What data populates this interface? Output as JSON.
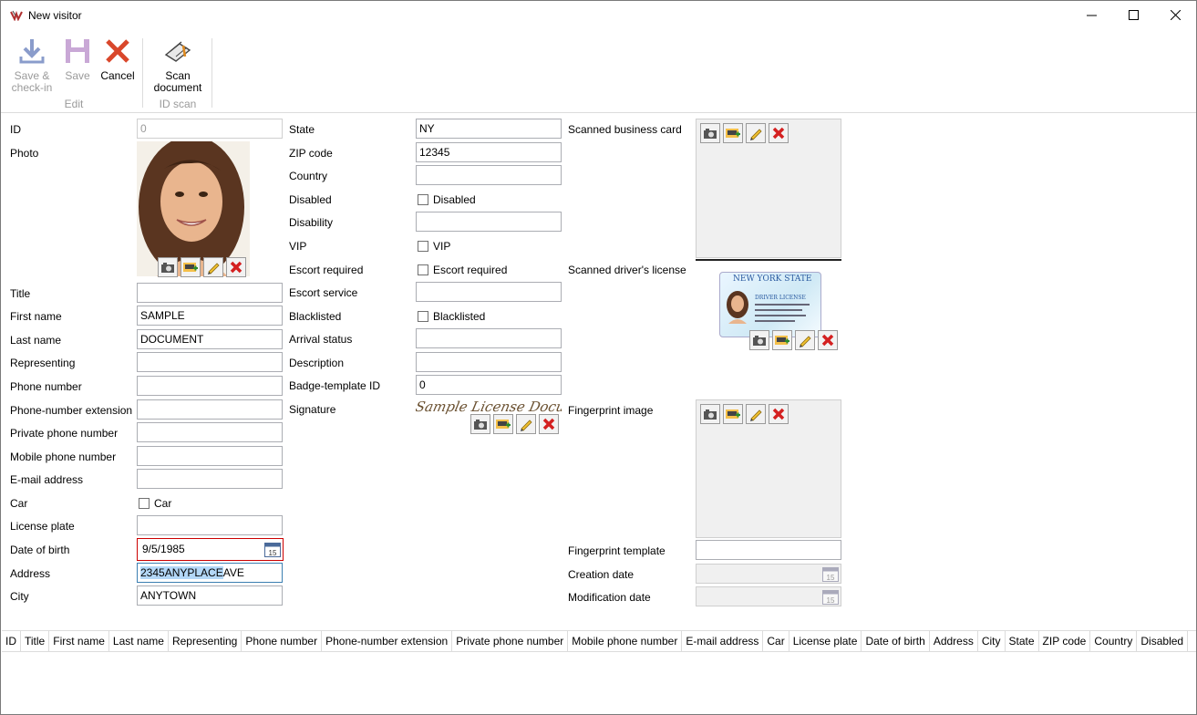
{
  "window": {
    "title": "New visitor"
  },
  "toolbar": {
    "save_checkin_line1": "Save &",
    "save_checkin_line2": "check-in",
    "save": "Save",
    "cancel": "Cancel",
    "scan_line1": "Scan",
    "scan_line2": "document",
    "group_edit": "Edit",
    "group_idscan": "ID scan"
  },
  "form": {
    "id": {
      "label": "ID",
      "value": "0"
    },
    "photo": {
      "label": "Photo"
    },
    "title": {
      "label": "Title",
      "value": ""
    },
    "first_name": {
      "label": "First name",
      "value": "SAMPLE"
    },
    "last_name": {
      "label": "Last name",
      "value": "DOCUMENT"
    },
    "representing": {
      "label": "Representing",
      "value": ""
    },
    "phone_number": {
      "label": "Phone number",
      "value": ""
    },
    "phone_ext": {
      "label": "Phone-number extension",
      "value": ""
    },
    "private_phone": {
      "label": "Private phone number",
      "value": ""
    },
    "mobile_phone": {
      "label": "Mobile phone number",
      "value": ""
    },
    "email": {
      "label": "E-mail address",
      "value": ""
    },
    "car": {
      "label": "Car",
      "check_label": "Car"
    },
    "license_plate": {
      "label": "License plate",
      "value": ""
    },
    "dob": {
      "label": "Date of birth",
      "value": "9/5/1985"
    },
    "address": {
      "label": "Address",
      "value_selected": "2345ANYPLACE",
      "value_rest": "AVE"
    },
    "city": {
      "label": "City",
      "value": "ANYTOWN"
    },
    "state": {
      "label": "State",
      "value": "NY"
    },
    "zip": {
      "label": "ZIP code",
      "value": "12345"
    },
    "country": {
      "label": "Country",
      "value": ""
    },
    "disabled": {
      "label": "Disabled",
      "check_label": "Disabled"
    },
    "disability": {
      "label": "Disability",
      "value": ""
    },
    "vip": {
      "label": "VIP",
      "check_label": "VIP"
    },
    "escort_required": {
      "label": "Escort required",
      "check_label": "Escort required"
    },
    "escort_service": {
      "label": "Escort service",
      "value": ""
    },
    "blacklisted": {
      "label": "Blacklisted",
      "check_label": "Blacklisted"
    },
    "arrival_status": {
      "label": "Arrival status",
      "value": ""
    },
    "description": {
      "label": "Description",
      "value": ""
    },
    "badge_template": {
      "label": "Badge-template ID",
      "value": "0"
    },
    "signature": {
      "label": "Signature",
      "text": "Sample License Document"
    },
    "business_card": {
      "label": "Scanned business card"
    },
    "drivers_license": {
      "label": "Scanned driver's license",
      "state_text": "NEW YORK STATE",
      "doc_text": "DRIVER LICENSE"
    },
    "fingerprint_image": {
      "label": "Fingerprint image"
    },
    "fingerprint_template": {
      "label": "Fingerprint template",
      "value": ""
    },
    "creation_date": {
      "label": "Creation date",
      "value": ""
    },
    "modification_date": {
      "label": "Modification date",
      "value": ""
    },
    "calendar_day": "15"
  },
  "grid": {
    "columns": [
      "ID",
      "Title",
      "First name",
      "Last name",
      "Representing",
      "Phone number",
      "Phone-number extension",
      "Private phone number",
      "Mobile phone number",
      "E-mail address",
      "Car",
      "License plate",
      "Date of birth",
      "Address",
      "City",
      "State",
      "ZIP code",
      "Country",
      "Disabled"
    ]
  },
  "colors": {
    "accent_red": "#d9472b",
    "selection": "#b3d7f7",
    "focus_border": "#cc0000"
  }
}
